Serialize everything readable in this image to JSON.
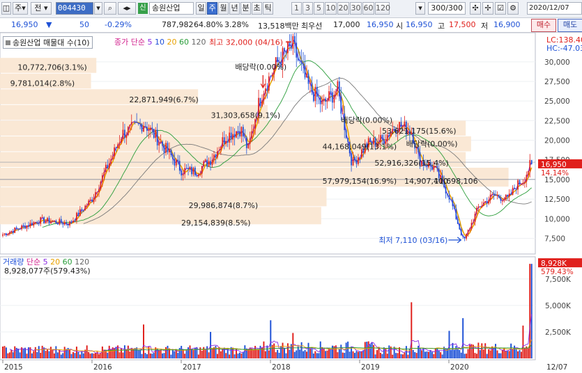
{
  "toolbar": {
    "type_label": "주",
    "jeon_label": "전",
    "stock_code": "004430",
    "new_badge": "신",
    "stock_name": "송원산업",
    "periods": [
      "일",
      "주",
      "월",
      "년",
      "분",
      "초",
      "틱"
    ],
    "active_period": "주",
    "intervals": [
      "1",
      "3",
      "5",
      "10",
      "20",
      "30",
      "60",
      "120"
    ],
    "count": "300/300",
    "date": "2020/12/07"
  },
  "quote": {
    "price": "16,950",
    "arrow": "▼",
    "change": "50",
    "change_pct": "-0.29%",
    "volume": "787,982",
    "ratio": "64.80%",
    "turnover": "3.28%",
    "amount": "13,518백만",
    "priority_label": "최우선",
    "ask": "17,000",
    "bid": "16,950",
    "open_label": "시",
    "open": "16,950",
    "high_label": "고",
    "high": "17,500",
    "low_label": "저",
    "low": "16,900",
    "buy_label": "매수",
    "sell_label": "매도"
  },
  "price_panel": {
    "legend_title": "송원산업 매물대 수(10)",
    "ma_label": "종가 단순",
    "ma_periods": [
      "5",
      "10",
      "20",
      "60",
      "120"
    ],
    "ma_colors": {
      "5": "#8a2be2",
      "10": "#1e4fd8",
      "20": "#e8a100",
      "60": "#2a9d3a",
      "120": "#666666"
    },
    "lc_label": "LC:138.40",
    "hc_label": "HC:-47.03",
    "current_price_tag": "16,950",
    "current_pct_tag": "14.14%",
    "high_annotation": "최고 32,000 (04/16)",
    "low_annotation": "최저 7,110 (03/16)",
    "dividend_labels": [
      "배당락(0.00%)",
      "배당락(0.00%)",
      "배당락(0.00%)"
    ],
    "volume_profile_labels": [
      "10,772,706(3.1%)",
      "9,781,014(2.8%)",
      "22,871,949(6.7%)",
      "31,303,658(9.1%)",
      "44,168,049(13.1%)",
      "53,621,175(15.6%)",
      "52,916,326(15.4%)",
      "57,979,154(16.9%)",
      "14,907,400",
      "11,698,106",
      "29,986,874(8.7%)",
      "29,154,839(8.5%)"
    ]
  },
  "volume_panel": {
    "legend_title": "거래량",
    "ma_label": "단순",
    "ma_periods": [
      "5",
      "20",
      "60",
      "120"
    ],
    "volume_text": "8,928,077주(579.43%)",
    "last_tag": "8,928K",
    "last_pct_tag": "579.43%"
  },
  "x_axis": {
    "years": [
      "2015",
      "2016",
      "2017",
      "2018",
      "2019",
      "2020"
    ],
    "end_label": "12/07"
  },
  "chart_data": [
    {
      "type": "candlestick",
      "title": "송원산업",
      "y_ticks": [
        30000,
        27500,
        25000,
        22500,
        20000,
        17500,
        15000,
        12500,
        10000,
        7500
      ],
      "ylim": [
        5500,
        33000
      ],
      "keypoints": [
        {
          "t": "2015-01",
          "v": 8000
        },
        {
          "t": "2015-06",
          "v": 9800
        },
        {
          "t": "2015-10",
          "v": 9400
        },
        {
          "t": "2016-01",
          "v": 12500
        },
        {
          "t": "2016-04",
          "v": 18500
        },
        {
          "t": "2016-05",
          "v": 20800
        },
        {
          "t": "2016-08",
          "v": 22200
        },
        {
          "t": "2016-10",
          "v": 20000
        },
        {
          "t": "2016-12",
          "v": 17500
        },
        {
          "t": "2017-01",
          "v": 16200
        },
        {
          "t": "2017-03",
          "v": 16000
        },
        {
          "t": "2017-05",
          "v": 17600
        },
        {
          "t": "2017-07",
          "v": 20500
        },
        {
          "t": "2017-09",
          "v": 21500
        },
        {
          "t": "2017-10",
          "v": 18700
        },
        {
          "t": "2017-11",
          "v": 23200
        },
        {
          "t": "2017-12",
          "v": 26500
        },
        {
          "t": "2018-02",
          "v": 30000
        },
        {
          "t": "2018-04",
          "v": 32000
        },
        {
          "t": "2018-06",
          "v": 27000
        },
        {
          "t": "2018-08",
          "v": 24500
        },
        {
          "t": "2018-10",
          "v": 26500
        },
        {
          "t": "2018-12",
          "v": 17000
        },
        {
          "t": "2019-02",
          "v": 19500
        },
        {
          "t": "2019-04",
          "v": 20000
        },
        {
          "t": "2019-06",
          "v": 22000
        },
        {
          "t": "2019-08",
          "v": 21200
        },
        {
          "t": "2019-09",
          "v": 17500
        },
        {
          "t": "2019-11",
          "v": 16500
        },
        {
          "t": "2020-01",
          "v": 13000
        },
        {
          "t": "2020-03",
          "v": 7110
        },
        {
          "t": "2020-05",
          "v": 11500
        },
        {
          "t": "2020-07",
          "v": 13000
        },
        {
          "t": "2020-09",
          "v": 12500
        },
        {
          "t": "2020-10",
          "v": 14200
        },
        {
          "t": "2020-11",
          "v": 14900
        },
        {
          "t": "2020-12",
          "v": 16950
        }
      ]
    },
    {
      "type": "bar",
      "title": "거래량",
      "y_ticks": [
        "7,500K",
        "5,000K",
        "2,500K"
      ],
      "ylim": [
        0,
        9200000
      ],
      "spikes": [
        {
          "t": "2016-08",
          "v": 3200000
        },
        {
          "t": "2017-05",
          "v": 2500000
        },
        {
          "t": "2018-01",
          "v": 3600000
        },
        {
          "t": "2018-04",
          "v": 2400000
        },
        {
          "t": "2019-08",
          "v": 5300000
        },
        {
          "t": "2020-01",
          "v": 2600000
        },
        {
          "t": "2020-03",
          "v": 3800000
        },
        {
          "t": "2020-11",
          "v": 3100000
        },
        {
          "t": "2020-12",
          "v": 8928077
        }
      ]
    }
  ]
}
